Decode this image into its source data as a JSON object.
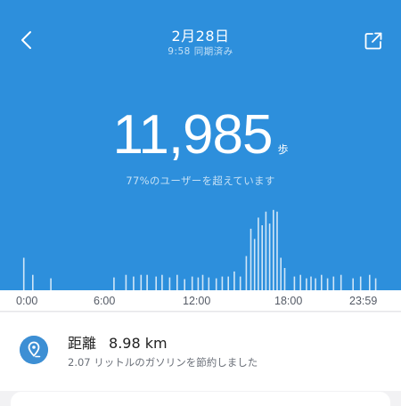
{
  "header": {
    "date": "2月28日",
    "sync_status": "9:58 同期済み"
  },
  "summary": {
    "steps": "11,985",
    "unit": "歩",
    "percentile_text": "77%のユーザーを超えています"
  },
  "chart_data": {
    "type": "bar",
    "title": "",
    "xlabel": "",
    "ylabel": "",
    "x_ticks": [
      "0:00",
      "6:00",
      "12:00",
      "18:00",
      "23:59"
    ],
    "x_range": [
      0,
      24
    ],
    "ylim": [
      0,
      100
    ],
    "series": [
      {
        "values": [
          [
            0.1,
            38
          ],
          [
            0.7,
            18
          ],
          [
            1.9,
            14
          ],
          [
            6.1,
            15
          ],
          [
            6.9,
            18
          ],
          [
            7.4,
            16
          ],
          [
            7.9,
            18
          ],
          [
            8.3,
            18
          ],
          [
            8.9,
            16
          ],
          [
            9.3,
            18
          ],
          [
            9.8,
            15
          ],
          [
            10.3,
            18
          ],
          [
            10.8,
            13
          ],
          [
            11.3,
            16
          ],
          [
            11.7,
            15
          ],
          [
            12.0,
            18
          ],
          [
            12.4,
            15
          ],
          [
            12.9,
            14
          ],
          [
            13.3,
            16
          ],
          [
            13.7,
            16
          ],
          [
            14.1,
            22
          ],
          [
            14.5,
            16
          ],
          [
            14.9,
            40
          ],
          [
            15.2,
            72
          ],
          [
            15.45,
            60
          ],
          [
            15.7,
            85
          ],
          [
            15.95,
            76
          ],
          [
            16.2,
            92
          ],
          [
            16.45,
            78
          ],
          [
            16.7,
            94
          ],
          [
            16.95,
            92
          ],
          [
            17.2,
            38
          ],
          [
            17.45,
            26
          ],
          [
            18.1,
            16
          ],
          [
            18.5,
            18
          ],
          [
            18.9,
            14
          ],
          [
            19.2,
            16
          ],
          [
            19.5,
            14
          ],
          [
            19.9,
            18
          ],
          [
            20.3,
            14
          ],
          [
            20.7,
            16
          ],
          [
            21.2,
            18
          ],
          [
            22.0,
            14
          ],
          [
            22.5,
            16
          ],
          [
            23.1,
            18
          ],
          [
            23.5,
            14
          ]
        ]
      }
    ]
  },
  "distance": {
    "icon": "location-pin-icon",
    "label": "距離",
    "value": "8.98 km",
    "subtitle": "2.07 リットルのガソリンを節約しました"
  },
  "colors": {
    "primary": "#2d8fdc",
    "icon_bg": "#3d8fd4"
  }
}
